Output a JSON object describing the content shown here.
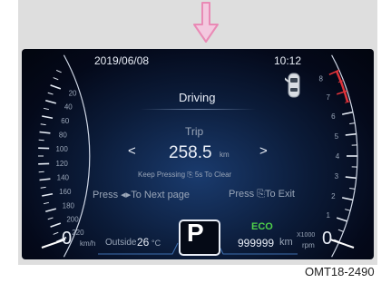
{
  "figure_code": "OMT18-2490",
  "status": {
    "date": "2019/06/08",
    "time": "10:12"
  },
  "screen": {
    "title": "Driving",
    "section": "Trip",
    "prev_arrow": "<",
    "next_arrow": ">",
    "trip_value": "258.5",
    "trip_unit": "km",
    "hint_clear": "Keep Pressing ⎘ 5s To Clear",
    "hint_next": "Press ◂▸To Next page",
    "hint_exit": "Press ⎘To Exit"
  },
  "speedometer": {
    "ticks": [
      "220",
      "200",
      "180",
      "160",
      "140",
      "120",
      "100",
      "80",
      "60",
      "40",
      "20"
    ],
    "value": "0",
    "unit": "km/h"
  },
  "tachometer": {
    "ticks": [
      "8",
      "7",
      "6",
      "5",
      "4",
      "3",
      "2",
      "1"
    ],
    "value": "0",
    "unit_multiplier": "X1000",
    "unit": "rpm"
  },
  "bottom": {
    "outside_label": "Outside",
    "outside_temp": "26",
    "temp_unit": "°C",
    "gear": "P",
    "eco_label": "ECO",
    "odometer": "999999",
    "odometer_unit": "km"
  },
  "colors": {
    "eco": "#4fd04a",
    "redline": "#e0333a",
    "arrow": "#e98ab5"
  }
}
